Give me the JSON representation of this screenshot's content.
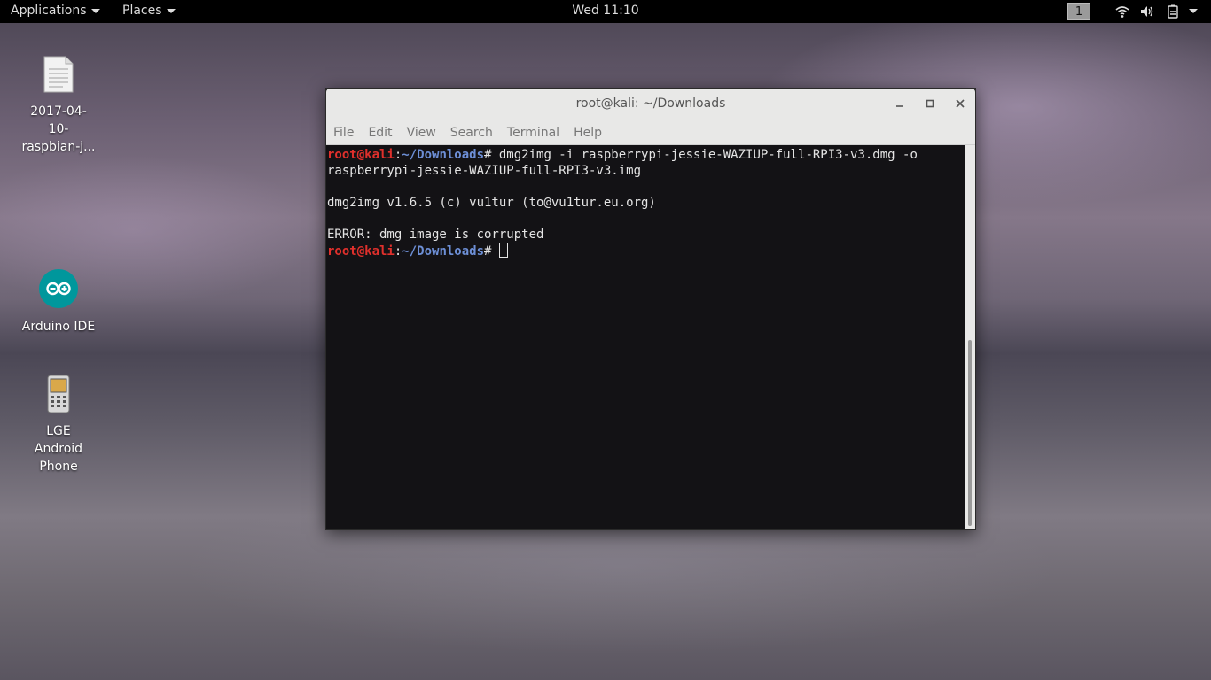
{
  "topbar": {
    "applications": "Applications",
    "places": "Places",
    "clock": "Wed 11:10",
    "workspace": "1"
  },
  "desktop": {
    "icons": [
      {
        "label": "2017-04-\n10-\nraspbian-j...",
        "icon": "document-icon"
      },
      {
        "label": "Arduino IDE",
        "icon": "arduino-icon"
      },
      {
        "label": "LGE\nAndroid\nPhone",
        "icon": "phone-icon"
      }
    ]
  },
  "window": {
    "title": "root@kali: ~/Downloads",
    "menu": [
      "File",
      "Edit",
      "View",
      "Search",
      "Terminal",
      "Help"
    ]
  },
  "terminal": {
    "user": "root@kali",
    "path": "~/Downloads",
    "sep": ":",
    "prompt_char": "# ",
    "command1": "dmg2img -i raspberrypi-jessie-WAZIUP-full-RPI3-v3.dmg -o",
    "command1_cont": "raspberrypi-jessie-WAZIUP-full-RPI3-v3.img",
    "output1": "dmg2img v1.6.5 (c) vu1tur (to@vu1tur.eu.org)",
    "output2": "ERROR: dmg image is corrupted"
  },
  "colors": {
    "prompt_user": "#e0302c",
    "prompt_path": "#6d8fd6"
  }
}
